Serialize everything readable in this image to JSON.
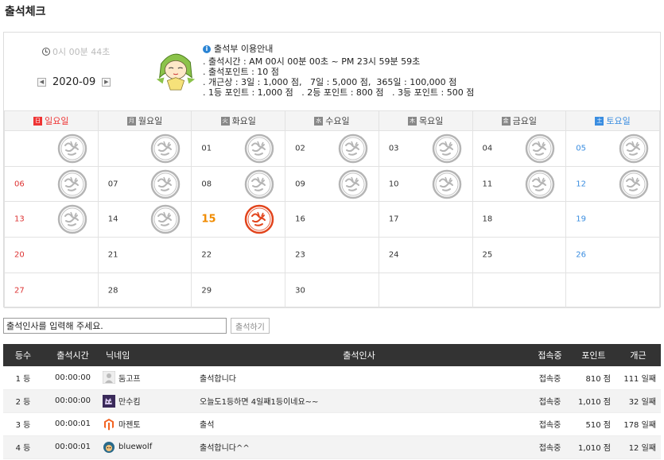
{
  "page": {
    "title": "출석체크"
  },
  "clock": {
    "text": "0시 00분 44초"
  },
  "month": {
    "label": "2020-09",
    "prev": "◀",
    "next": "▶"
  },
  "info": {
    "title": "출석부 이용안내",
    "lines": [
      ". 출석시간 : AM 00시 00분 00초 ~ PM 23시 59분 59초",
      ". 출석포인트 : 10 점",
      ". 개근상 : 3일 : 1,000 점,   7일 : 5,000 점,  365일 : 100,000 점",
      ". 1등 포인트 : 1,000 점   . 2등 포인트 : 800 점   . 3등 포인트 : 500 점"
    ]
  },
  "weekdays": [
    {
      "badge": "日",
      "label": "일요일"
    },
    {
      "badge": "月",
      "label": "월요일"
    },
    {
      "badge": "火",
      "label": "화요일"
    },
    {
      "badge": "水",
      "label": "수요일"
    },
    {
      "badge": "木",
      "label": "목요일"
    },
    {
      "badge": "金",
      "label": "금요일"
    },
    {
      "badge": "土",
      "label": "토요일"
    }
  ],
  "weeks": [
    [
      {
        "d": "",
        "s": "gray"
      },
      {
        "d": "",
        "s": "gray"
      },
      {
        "d": "01",
        "s": "gray"
      },
      {
        "d": "02",
        "s": "gray"
      },
      {
        "d": "03",
        "s": "gray"
      },
      {
        "d": "04",
        "s": "gray"
      },
      {
        "d": "05",
        "s": "gray"
      }
    ],
    [
      {
        "d": "06",
        "s": "gray"
      },
      {
        "d": "07",
        "s": "gray"
      },
      {
        "d": "08",
        "s": "gray"
      },
      {
        "d": "09",
        "s": "gray"
      },
      {
        "d": "10",
        "s": "gray"
      },
      {
        "d": "11",
        "s": "gray"
      },
      {
        "d": "12",
        "s": "gray"
      }
    ],
    [
      {
        "d": "13",
        "s": "gray"
      },
      {
        "d": "14",
        "s": "gray"
      },
      {
        "d": "15",
        "s": "red",
        "today": true
      },
      {
        "d": "16",
        "s": ""
      },
      {
        "d": "17",
        "s": ""
      },
      {
        "d": "18",
        "s": ""
      },
      {
        "d": "19",
        "s": ""
      }
    ],
    [
      {
        "d": "20",
        "s": ""
      },
      {
        "d": "21",
        "s": ""
      },
      {
        "d": "22",
        "s": ""
      },
      {
        "d": "23",
        "s": ""
      },
      {
        "d": "24",
        "s": ""
      },
      {
        "d": "25",
        "s": ""
      },
      {
        "d": "26",
        "s": ""
      }
    ],
    [
      {
        "d": "27",
        "s": ""
      },
      {
        "d": "28",
        "s": ""
      },
      {
        "d": "29",
        "s": ""
      },
      {
        "d": "30",
        "s": ""
      },
      {
        "d": "",
        "s": ""
      },
      {
        "d": "",
        "s": ""
      },
      {
        "d": "",
        "s": ""
      }
    ]
  ],
  "greeting": {
    "placeholder": "출석인사를 입력해 주세요.",
    "button": "출석하기"
  },
  "ranking": {
    "headers": [
      "등수",
      "출석시간",
      "닉네임",
      "출석인사",
      "접속중",
      "포인트",
      "개근"
    ],
    "rows": [
      {
        "rank": "1 등",
        "time": "00:00:00",
        "nick": "둠고프",
        "icon": "user-icon",
        "msg": "출석합니다",
        "status": "접속중",
        "points": "810 점",
        "streak": "111 일째"
      },
      {
        "rank": "2 등",
        "time": "00:00:00",
        "nick": "만수킴",
        "icon": "cat-icon",
        "msg": "오늘도1등하면 4일째1등이네요~~",
        "status": "접속중",
        "points": "1,010 점",
        "streak": "32 일째"
      },
      {
        "rank": "3 등",
        "time": "00:00:01",
        "nick": "마젠토",
        "icon": "magento-icon",
        "msg": "출석",
        "status": "접속중",
        "points": "510 점",
        "streak": "178 일째"
      },
      {
        "rank": "4 등",
        "time": "00:00:01",
        "nick": "bluewolf",
        "icon": "wolf-icon",
        "msg": "출석합니다^^",
        "status": "접속중",
        "points": "1,010 점",
        "streak": "12 일째"
      }
    ]
  },
  "colors": {
    "sunday": "#dd3333",
    "saturday": "#3a8de0",
    "today": "#f08b00",
    "stamp_red": "#e2441c",
    "stamp_gray": "#b5b5b5",
    "header_dark": "#333333"
  }
}
